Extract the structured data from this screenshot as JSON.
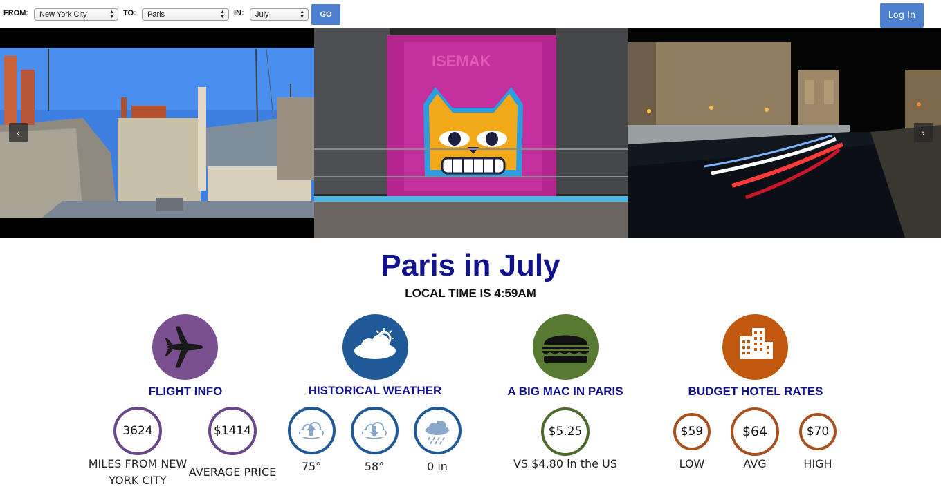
{
  "search": {
    "from_label": "FROM:",
    "from_value": "New York City",
    "to_label": "TO:",
    "to_value": "Paris",
    "in_label": "IN:",
    "in_value": "July",
    "go_label": "GO"
  },
  "header": {
    "login_label": "Log In"
  },
  "carousel": {
    "prev_icon": "‹",
    "next_icon": "›"
  },
  "main": {
    "title": "Paris in July",
    "local_time": "LOCAL TIME IS 4:59AM"
  },
  "flight": {
    "heading": "FLIGHT INFO",
    "miles_value": "3624",
    "miles_label_line1": "MILES FROM NEW",
    "miles_label_line2": "YORK CITY",
    "price_value": "$1414",
    "price_label": "AVERAGE PRICE",
    "icon": "airplane-icon",
    "color": "#7a5090"
  },
  "weather": {
    "heading": "HISTORICAL WEATHER",
    "high_value": "75°",
    "low_value": "58°",
    "precip_value": "0 in",
    "icon": "partly-cloudy-icon",
    "color": "#1f5a96"
  },
  "bigmac": {
    "heading": "A BIG MAC IN PARIS",
    "price_value": "$5.25",
    "compare_label": "VS $4.80 in the US",
    "icon": "burger-icon",
    "color": "#567a32"
  },
  "hotel": {
    "heading": "BUDGET HOTEL RATES",
    "low_value": "$59",
    "low_label": "LOW",
    "avg_value": "$64",
    "avg_label": "AVG",
    "high_value": "$70",
    "high_label": "HIGH",
    "icon": "hotel-building-icon",
    "color": "#c0590f"
  }
}
